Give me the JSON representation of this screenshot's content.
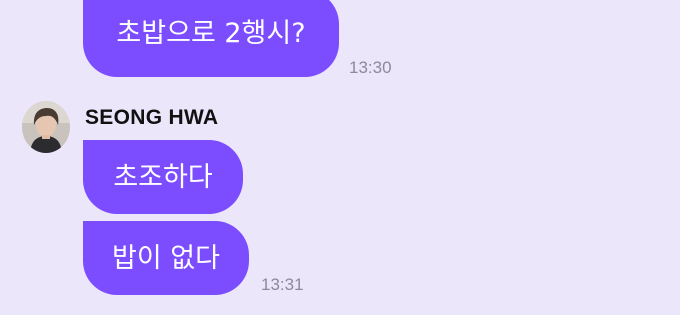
{
  "conversation": {
    "messages": [
      {
        "sender": "me",
        "text": "초밥으로 2행시?",
        "time": "13:30"
      },
      {
        "sender": "SEONG HWA",
        "text": "초조하다"
      },
      {
        "sender": "SEONG HWA",
        "text": "밥이 없다",
        "time": "13:31"
      }
    ]
  },
  "contact": {
    "name": "SEONG HWA",
    "avatar_icon": "profile-photo"
  },
  "colors": {
    "background": "#ece6fb",
    "bubble": "#7c4dff",
    "bubble_text": "#ffffff",
    "timestamp": "#8d8a98"
  }
}
